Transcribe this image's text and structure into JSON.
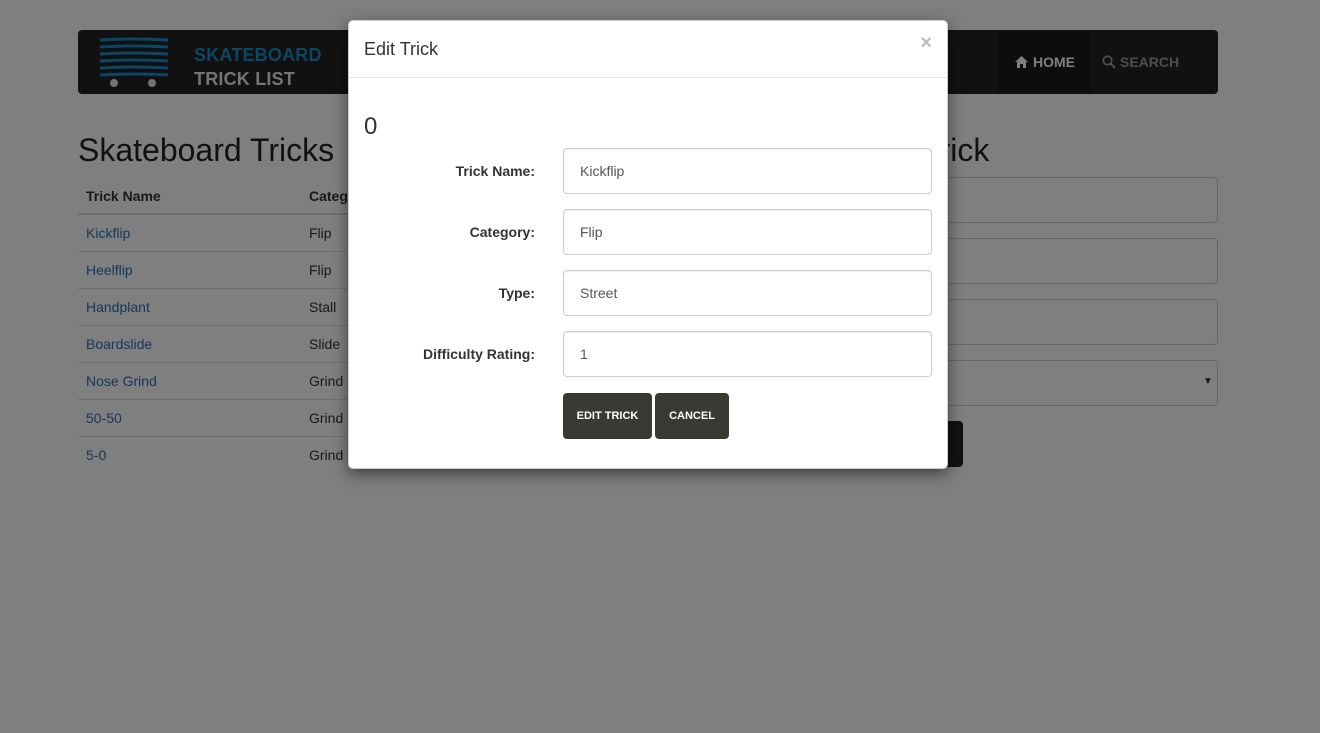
{
  "brand": {
    "line1": "SKATEBOARD",
    "line2": "TRICK LIST",
    "accent_color": "#1a8bc8"
  },
  "nav": {
    "home_label": "HOME",
    "home_icon": "home-icon",
    "search_label": "SEARCH",
    "search_icon": "search-icon"
  },
  "tricks_section": {
    "title": "Skateboard Tricks",
    "columns": [
      "Trick Name",
      "Categ"
    ],
    "rows": [
      {
        "name": "Kickflip",
        "category": "Flip"
      },
      {
        "name": "Heelflip",
        "category": "Flip"
      },
      {
        "name": "Handplant",
        "category": "Stall"
      },
      {
        "name": "Boardslide",
        "category": "Slide"
      },
      {
        "name": "Nose Grind",
        "category": "Grind"
      },
      {
        "name": "50-50",
        "category": "Grind"
      },
      {
        "name": "5-0",
        "category": "Grind"
      }
    ]
  },
  "new_trick_section": {
    "title": "ew Trick"
  },
  "modal": {
    "title": "Edit Trick",
    "close_glyph": "×",
    "trick_id": "0",
    "fields": {
      "trick_name": {
        "label": "Trick Name:",
        "value": "Kickflip"
      },
      "category": {
        "label": "Category:",
        "value": "Flip"
      },
      "type": {
        "label": "Type:",
        "value": "Street"
      },
      "difficulty": {
        "label": "Difficulty Rating:",
        "value": "1"
      }
    },
    "edit_button": "EDIT TRICK",
    "cancel_button": "CANCEL"
  }
}
